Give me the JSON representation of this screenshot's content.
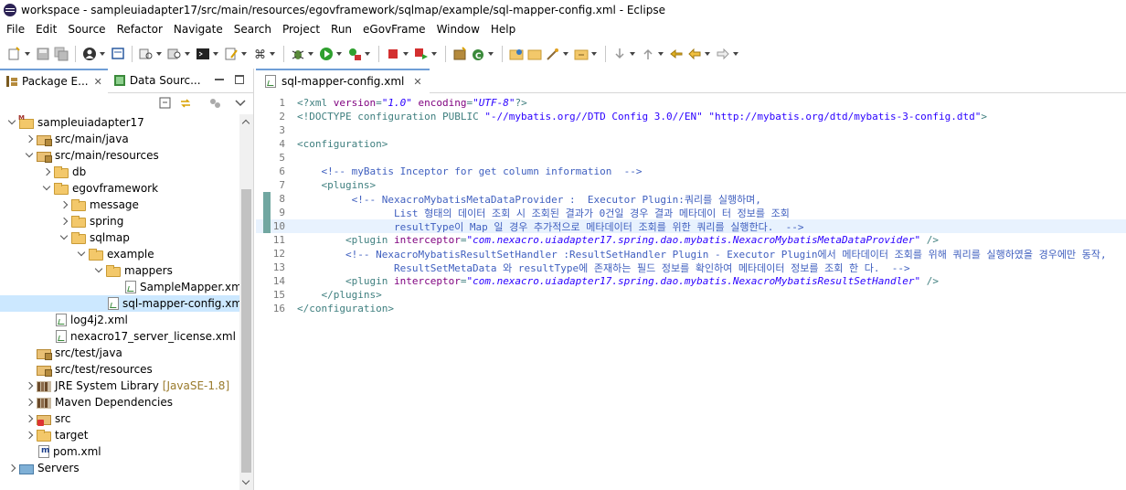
{
  "window": {
    "title": "workspace - sampleuiadapter17/src/main/resources/egovframework/sqlmap/example/sql-mapper-config.xml - Eclipse"
  },
  "menu": [
    "File",
    "Edit",
    "Source",
    "Refactor",
    "Navigate",
    "Search",
    "Project",
    "Run",
    "eGovFrame",
    "Window",
    "Help"
  ],
  "left_view": {
    "tabs": [
      {
        "label": "Package E...",
        "icon": "package-explorer-icon",
        "active": true
      },
      {
        "label": "Data Sourc...",
        "icon": "data-source-icon",
        "active": false
      }
    ],
    "tree": [
      {
        "label": "sampleuiadapter17",
        "indent": 0,
        "chevron": "down",
        "icon": "project"
      },
      {
        "label": "src/main/java",
        "indent": 1,
        "chevron": "right",
        "icon": "pkgfolder"
      },
      {
        "label": "src/main/resources",
        "indent": 1,
        "chevron": "down",
        "icon": "pkgfolder"
      },
      {
        "label": "db",
        "indent": 2,
        "chevron": "right",
        "icon": "folder"
      },
      {
        "label": "egovframework",
        "indent": 2,
        "chevron": "down",
        "icon": "folder"
      },
      {
        "label": "message",
        "indent": 3,
        "chevron": "right",
        "icon": "folder"
      },
      {
        "label": "spring",
        "indent": 3,
        "chevron": "right",
        "icon": "folder"
      },
      {
        "label": "sqlmap",
        "indent": 3,
        "chevron": "down",
        "icon": "folder"
      },
      {
        "label": "example",
        "indent": 4,
        "chevron": "down",
        "icon": "folder"
      },
      {
        "label": "mappers",
        "indent": 5,
        "chevron": "down",
        "icon": "folder"
      },
      {
        "label": "SampleMapper.xml",
        "indent": 6,
        "chevron": "none",
        "icon": "xmlfile"
      },
      {
        "label": "sql-mapper-config.xml",
        "indent": 5,
        "chevron": "none",
        "icon": "xmlfile",
        "selected": true
      },
      {
        "label": "log4j2.xml",
        "indent": 2,
        "chevron": "none",
        "icon": "xmlfile"
      },
      {
        "label": "nexacro17_server_license.xml",
        "indent": 2,
        "chevron": "none",
        "icon": "xmlfile"
      },
      {
        "label": "src/test/java",
        "indent": 1,
        "chevron": "none",
        "icon": "pkgfolder"
      },
      {
        "label": "src/test/resources",
        "indent": 1,
        "chevron": "none",
        "icon": "pkgfolder"
      },
      {
        "label": "JRE System Library",
        "indent": 1,
        "chevron": "right",
        "icon": "lib",
        "decoration": "[JavaSE-1.8]"
      },
      {
        "label": "Maven Dependencies",
        "indent": 1,
        "chevron": "right",
        "icon": "lib"
      },
      {
        "label": "src",
        "indent": 1,
        "chevron": "right",
        "icon": "srcerr"
      },
      {
        "label": "target",
        "indent": 1,
        "chevron": "right",
        "icon": "folder"
      },
      {
        "label": "pom.xml",
        "indent": 1,
        "chevron": "none",
        "icon": "pomfile"
      },
      {
        "label": "Servers",
        "indent": 0,
        "chevron": "right",
        "icon": "servers"
      }
    ]
  },
  "editor": {
    "tab_label": "sql-mapper-config.xml",
    "lines": [
      {
        "n": "1",
        "segments": [
          [
            "pi",
            "<?xml "
          ],
          [
            "attr",
            "version"
          ],
          [
            "tag",
            "="
          ],
          [
            "val",
            "\"1.0\""
          ],
          [
            "tag",
            " "
          ],
          [
            "attr",
            "encoding"
          ],
          [
            "tag",
            "="
          ],
          [
            "val",
            "\"UTF-8\""
          ],
          [
            "pi",
            "?>"
          ]
        ]
      },
      {
        "n": "2",
        "segments": [
          [
            "doctype",
            "<!DOCTYPE "
          ],
          [
            "tag",
            "configuration"
          ],
          [
            "doctype",
            " PUBLIC "
          ],
          [
            "str",
            "\"-//mybatis.org//DTD Config 3.0//EN\""
          ],
          [
            "tag",
            " "
          ],
          [
            "str",
            "\"http://mybatis.org/dtd/mybatis-3-config.dtd\""
          ],
          [
            "doctype",
            ">"
          ]
        ]
      },
      {
        "n": "3",
        "segments": []
      },
      {
        "n": "4",
        "segments": [
          [
            "tag",
            "<configuration>"
          ]
        ]
      },
      {
        "n": "5",
        "segments": []
      },
      {
        "n": "6",
        "segments": [
          [
            "tag",
            "    "
          ],
          [
            "comment",
            "<!-- myBatis Inceptor for get column information  -->"
          ]
        ]
      },
      {
        "n": "7",
        "segments": [
          [
            "tag",
            "    <plugins>"
          ]
        ]
      },
      {
        "n": "8",
        "segments": [
          [
            "comment",
            "         <!-- NexacroMybatisMetaDataProvider :  Executor Plugin:쿼리를 실행하며,"
          ]
        ],
        "mark": true
      },
      {
        "n": "9",
        "segments": [
          [
            "comment",
            "                List 형태의 데이터 조회 시 조회된 결과가 0건일 경우 결과 메타데이 터 정보를 조회"
          ]
        ],
        "mark": true
      },
      {
        "n": "10",
        "segments": [
          [
            "comment",
            "                resultType이 Map 일 경우 추가적으로 메타데이터 조회를 위한 쿼리를 실행한다.  -->"
          ]
        ],
        "mark": true,
        "current": true
      },
      {
        "n": "11",
        "segments": [
          [
            "tag",
            "        <plugin "
          ],
          [
            "attr",
            "interceptor"
          ],
          [
            "tag",
            "="
          ],
          [
            "val",
            "\"com.nexacro.uiadapter17.spring.dao.mybatis.NexacroMybatisMetaDataProvider\""
          ],
          [
            "tag",
            " />"
          ]
        ]
      },
      {
        "n": "12",
        "segments": [
          [
            "comment",
            "        <!-- NexacroMybatisResultSetHandler :ResultSetHandler Plugin - Executor Plugin에서 메타데이터 조회를 위해 쿼리를 실행하였을 경우에만 동작,"
          ]
        ]
      },
      {
        "n": "13",
        "segments": [
          [
            "comment",
            "                ResultSetMetaData 와 resultType에 존재하는 필드 정보를 확인하여 메타데이터 정보를 조회 한 다.  -->"
          ]
        ]
      },
      {
        "n": "14",
        "segments": [
          [
            "tag",
            "        <plugin "
          ],
          [
            "attr",
            "interceptor"
          ],
          [
            "tag",
            "="
          ],
          [
            "val",
            "\"com.nexacro.uiadapter17.spring.dao.mybatis.NexacroMybatisResultSetHandler\""
          ],
          [
            "tag",
            " />"
          ]
        ]
      },
      {
        "n": "15",
        "segments": [
          [
            "tag",
            "    </plugins>"
          ]
        ]
      },
      {
        "n": "16",
        "segments": [
          [
            "tag",
            "</configuration>"
          ]
        ]
      }
    ]
  },
  "colors": {
    "selection": "#cce8ff",
    "current_line": "#e8f2fe",
    "tab_accent": "#6f9ed6",
    "gutter_mark": "#71a7a1"
  }
}
